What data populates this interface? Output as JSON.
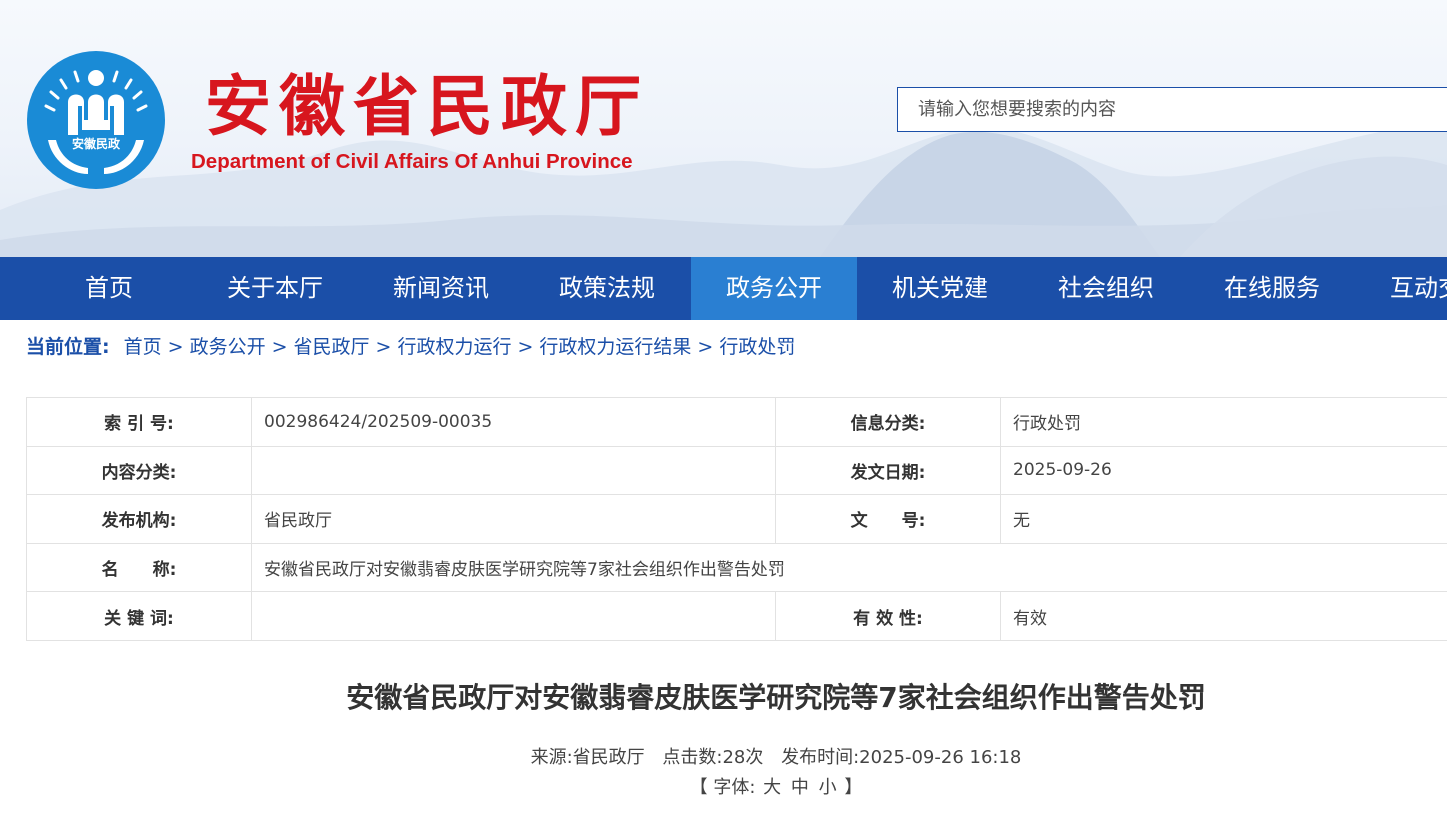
{
  "header": {
    "title_cn": "安徽省民政厅",
    "title_en": "Department of Civil Affairs Of Anhui Province",
    "emblem_text": "安徽民政",
    "search_placeholder": "请输入您想要搜索的内容",
    "colors": {
      "brand_red": "#d7161e",
      "emblem_blue": "#1a8bd6"
    }
  },
  "nav": {
    "active_index": 4,
    "items": [
      {
        "label": "首页"
      },
      {
        "label": "关于本厅"
      },
      {
        "label": "新闻资讯"
      },
      {
        "label": "政策法规"
      },
      {
        "label": "政务公开"
      },
      {
        "label": "机关党建"
      },
      {
        "label": "社会组织"
      },
      {
        "label": "在线服务"
      },
      {
        "label": "互动交流"
      }
    ],
    "colors": {
      "bar": "#1b4fa8",
      "active": "#2a7fd2"
    }
  },
  "breadcrumb": {
    "label": "当前位置:",
    "separator": ">",
    "items": [
      "首页",
      "政务公开",
      "省民政厅",
      "行政权力运行",
      "行政权力运行结果",
      "行政处罚"
    ]
  },
  "meta": {
    "index_no": {
      "key": "索 引 号:",
      "value": "002986424/202509-00035"
    },
    "info_category": {
      "key": "信息分类:",
      "value": "行政处罚"
    },
    "content_category": {
      "key": "内容分类:",
      "value": ""
    },
    "publish_date": {
      "key": "发文日期:",
      "value": "2025-09-26"
    },
    "publisher": {
      "key": "发布机构:",
      "value": "省民政厅"
    },
    "doc_no": {
      "key": "文　　号:",
      "value": "无"
    },
    "name": {
      "key": "名　　称:",
      "value": "安徽省民政厅对安徽翡睿皮肤医学研究院等7家社会组织作出警告处罚"
    },
    "keywords": {
      "key": "关 键 词:",
      "value": ""
    },
    "validity": {
      "key": "有 效 性:",
      "value": "有效"
    }
  },
  "article": {
    "title": "安徽省民政厅对安徽翡睿皮肤医学研究院等7家社会组织作出警告处罚",
    "source": "来源:省民政厅",
    "clicks": "点击数:28次",
    "publish_time": "发布时间:2025-09-26 16:18",
    "font_bar": {
      "open": "【 字体:",
      "large": "大",
      "medium": "中",
      "small": "小",
      "close": "】"
    }
  }
}
